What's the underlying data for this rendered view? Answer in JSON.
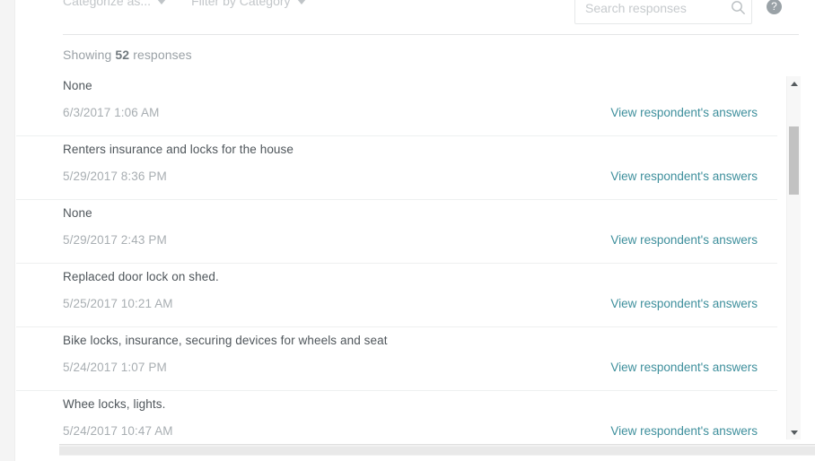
{
  "toolbar": {
    "categorize_label": "Categorize as...",
    "filter_label": "Filter by Category",
    "search_placeholder": "Search responses",
    "search_value": "",
    "search_icon": "search-icon",
    "help_icon": "?"
  },
  "results": {
    "showing_prefix": "Showing",
    "count": "52",
    "showing_suffix": "responses",
    "link_label": "View respondent's answers",
    "rows": [
      {
        "text": "None",
        "date": "6/3/2017 1:06 AM",
        "link": "View respondent's answers"
      },
      {
        "text": "Renters insurance and locks for the house",
        "date": "5/29/2017 8:36 PM",
        "link": "View respondent's answers"
      },
      {
        "text": "None",
        "date": "5/29/2017 2:43 PM",
        "link": "View respondent's answers"
      },
      {
        "text": "Replaced door lock on shed.",
        "date": "5/25/2017 10:21 AM",
        "link": "View respondent's answers"
      },
      {
        "text": "Bike locks, insurance, securing devices for wheels and seat",
        "date": "5/24/2017 1:07 PM",
        "link": "View respondent's answers"
      },
      {
        "text": "Whee locks, lights.",
        "date": "5/24/2017 10:47 AM",
        "link": "View respondent's answers"
      }
    ]
  },
  "colors": {
    "link": "#3e8f9c",
    "body_text": "#4f565b",
    "muted_text": "#a8aeb2",
    "divider": "#eef0f0",
    "scroll_thumb": "#c2c2c2"
  }
}
